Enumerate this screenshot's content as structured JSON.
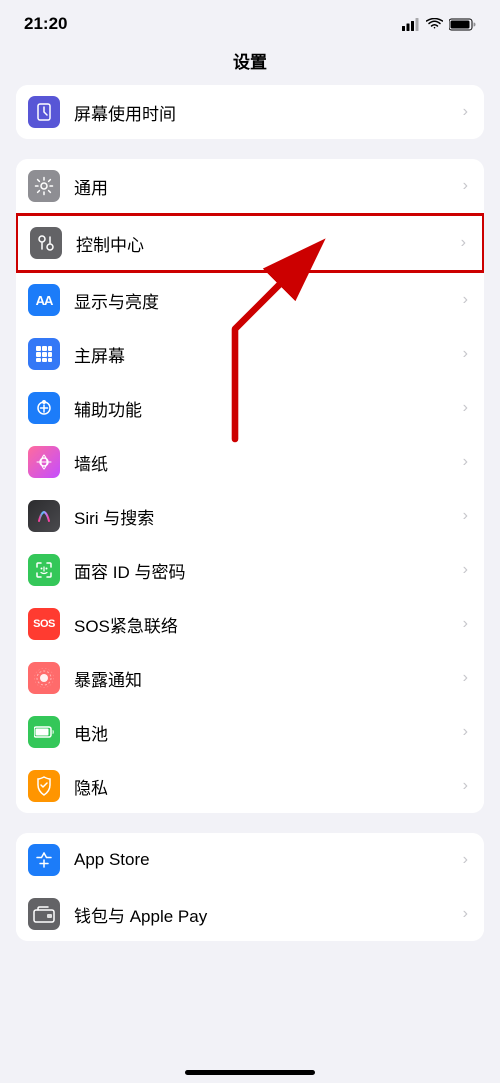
{
  "statusBar": {
    "time": "21:20",
    "signalAlt": "signal",
    "wifiAlt": "wifi",
    "batteryAlt": "battery"
  },
  "pageTitle": "设置",
  "groups": [
    {
      "id": "group-screentime",
      "items": [
        {
          "id": "screentime",
          "label": "屏幕使用时间",
          "iconBg": "screentime",
          "iconSymbol": "hourglass"
        }
      ]
    },
    {
      "id": "group-general",
      "items": [
        {
          "id": "general",
          "label": "通用",
          "iconBg": "gray",
          "iconSymbol": "gear"
        },
        {
          "id": "control-center",
          "label": "控制中心",
          "iconBg": "gray2",
          "iconSymbol": "sliders",
          "highlighted": true
        },
        {
          "id": "display",
          "label": "显示与亮度",
          "iconBg": "blue-aa",
          "iconSymbol": "aa"
        },
        {
          "id": "home-screen",
          "label": "主屏幕",
          "iconBg": "blue-grid",
          "iconSymbol": "grid"
        },
        {
          "id": "accessibility",
          "label": "辅助功能",
          "iconBg": "blue-accessibility",
          "iconSymbol": "person-circle"
        },
        {
          "id": "wallpaper",
          "label": "墙纸",
          "iconBg": "pink",
          "iconSymbol": "flower"
        },
        {
          "id": "siri",
          "label": "Siri 与搜索",
          "iconBg": "siri",
          "iconSymbol": "siri"
        },
        {
          "id": "faceid",
          "label": "面容 ID 与密码",
          "iconBg": "green-faceid",
          "iconSymbol": "faceid"
        },
        {
          "id": "sos",
          "label": "SOS紧急联络",
          "iconBg": "red-sos",
          "iconSymbol": "sos"
        },
        {
          "id": "exposure",
          "label": "暴露通知",
          "iconBg": "purple-exposure",
          "iconSymbol": "exposure"
        },
        {
          "id": "battery",
          "label": "电池",
          "iconBg": "green-battery",
          "iconSymbol": "battery"
        },
        {
          "id": "privacy",
          "label": "隐私",
          "iconBg": "orange-privacy",
          "iconSymbol": "hand"
        }
      ]
    },
    {
      "id": "group-apps",
      "items": [
        {
          "id": "appstore",
          "label": "App Store",
          "iconBg": "blue-appstore",
          "iconSymbol": "appstore"
        },
        {
          "id": "wallet",
          "label": "钱包与 Apple Pay",
          "iconBg": "gray-wallet",
          "iconSymbol": "wallet"
        }
      ]
    }
  ]
}
